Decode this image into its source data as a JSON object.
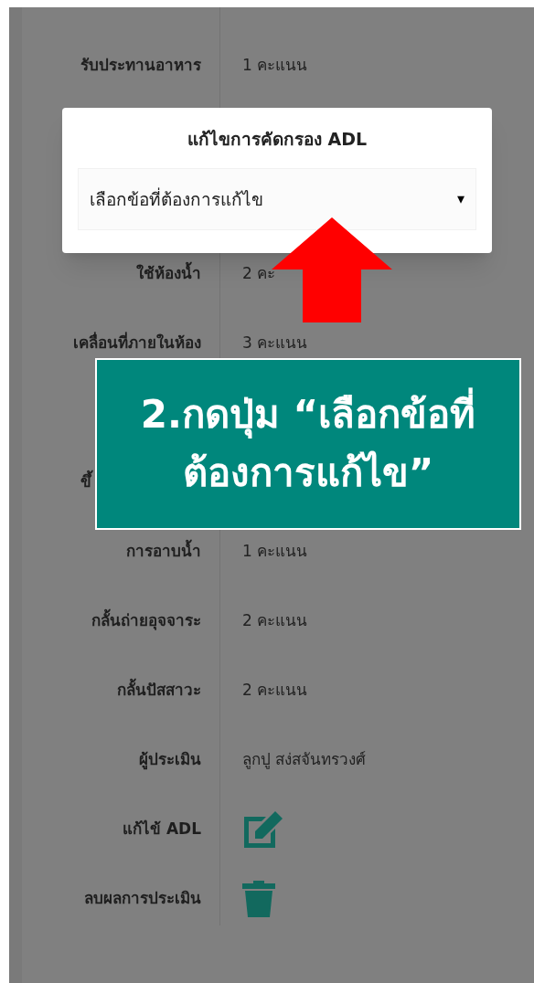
{
  "rows": [
    {
      "kind": "score",
      "label": "รับประทานอาหาร",
      "value": "1 คะแนน"
    },
    {
      "kind": "covered"
    },
    {
      "kind": "covered"
    },
    {
      "kind": "score",
      "label": "ใช้ห้องน้ำ",
      "value": "2 คะ"
    },
    {
      "kind": "score",
      "label": "เคลื่อนที่ภายในห้อง",
      "value": "3 คะแนน"
    },
    {
      "kind": "covered"
    },
    {
      "kind": "partial",
      "label": "ขึ้"
    },
    {
      "kind": "score",
      "label": "การอาบน้ำ",
      "value": "1 คะแนน"
    },
    {
      "kind": "score",
      "label": "กลั้นถ่ายอุจจาระ",
      "value": "2 คะแนน"
    },
    {
      "kind": "score",
      "label": "กลั้นปัสสาวะ",
      "value": "2 คะแนน"
    },
    {
      "kind": "score",
      "label": "ผู้ประเมิน",
      "value": "ลูกปู สง่สจันทรวงศ์"
    },
    {
      "kind": "edit",
      "label": "แก้ไข้ ADL"
    },
    {
      "kind": "delete",
      "label": "ลบผลการประเมิน"
    }
  ],
  "dialog": {
    "title": "แก้ไขการคัดกรอง ADL",
    "select": {
      "value": "เลือกข้อที่ต้องการแก้ไข",
      "caret": "▾"
    }
  },
  "callout": {
    "lines": [
      "2.กดปุ่ม “เลือกข้อที่",
      "ต้องการแก้ไข”"
    ]
  }
}
